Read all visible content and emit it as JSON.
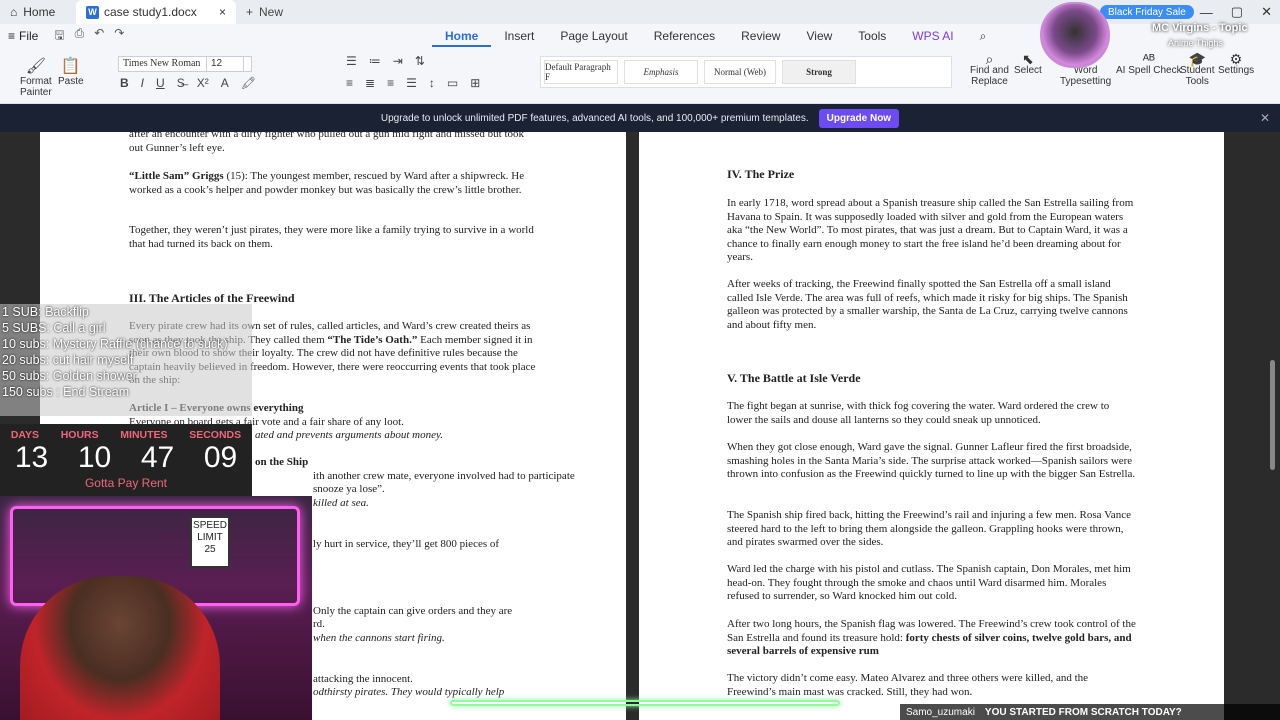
{
  "titlebar": {
    "home": "Home",
    "doc_tab": "case study1.docx",
    "new_tab": "New",
    "promo": "Black Friday Sale"
  },
  "menubar": {
    "file": "File",
    "tabs": [
      "Home",
      "Insert",
      "Page Layout",
      "References",
      "Review",
      "View",
      "Tools",
      "WPS AI"
    ]
  },
  "ribbon": {
    "format_painter": "Format\nPainter",
    "paste": "Paste",
    "font": "Times New Roman",
    "size": "12",
    "styles": [
      "Default Paragraph F",
      "Emphasis",
      "Normal (Web)",
      "Strong"
    ],
    "find_replace": "Find and\nReplace",
    "select": "Select",
    "word_typesetting": "Word\nTypesetting",
    "ai_spell": "AI Spell Check",
    "student_tools": "Student\nTools",
    "settings": "Settings"
  },
  "upgrade": {
    "text": "Upgrade to unlock unlimited PDF features, advanced AI tools, and 100,000+ premium templates.",
    "button": "Upgrade Now"
  },
  "left_page": {
    "p1": "after an encounter with a dirty fighter who pulled out a gun mid fight and missed but took out Gunner’s left eye.",
    "p2_bold": "“Little Sam” Griggs",
    "p2": " (15): The youngest member, rescued by Ward after a shipwreck. He worked as a cook’s helper and powder monkey but was basically the crew’s little brother.",
    "p3": "Together, they weren’t just pirates, they were more like a family trying to survive in a world that had turned its back on them.",
    "h3": "III. The Articles of the Freewind",
    "p4a": "Every pirate crew had its own set of rules, called articles, and Ward’s crew created theirs as soon as they took the ship. They called them ",
    "p4b": "“The Tide’s Oath.”",
    "p4c": " Each member signed it in their own blood to show their loyalty. The crew did not have definitive rules because the captain heavily believed in freedom. However, there were reoccurring events that took place on the ship:",
    "art1": "Article I – Everyone owns everything",
    "art1a": "Everyone on board gets a fair vote and a fair share of any loot.",
    "art1b": "ated and prevents arguments about money.",
    "art2": "on the Ship",
    "art2a": "ith another crew mate, everyone involved had to participate",
    "art2b": "snooze ya lose”.",
    "art2c": "killed at sea.",
    "art3": "ly hurt in service, they’ll get 800 pieces of",
    "art4": "Only the captain can give orders and they are",
    "art4b": "rd.",
    "art4c": " when the cannons start firing.",
    "art5": "attacking the innocent.",
    "art5b": "odthirsty pirates. They would typically help"
  },
  "right_page": {
    "h4": "IV. The Prize",
    "r1": "In early 1718, word spread about a Spanish treasure ship called the San Estrella sailing from Havana to Spain. It was supposedly loaded with silver and gold from the European waters aka “the New World”. To most pirates, that was just a dream. But to Captain Ward, it was a chance to finally earn enough money to start the free island he’d been dreaming about for years.",
    "r2": "After weeks of tracking, the Freewind finally spotted the San Estrella off a small island called Isle Verde. The area was full of reefs, which made it risky for big ships. The Spanish galleon was protected by a smaller warship, the Santa de La Cruz, carrying twelve cannons and about fifty men.",
    "h5": "V. The Battle at Isle Verde",
    "r3": "The fight began at sunrise, with thick fog covering the water. Ward ordered the crew to lower the sails and douse all lanterns so they could sneak up unnoticed.",
    "r4": "When they got close enough, Ward gave the signal. Gunner Lafleur fired the first broadside, smashing holes in the Santa Maria’s side. The surprise attack worked—Spanish sailors were thrown into confusion as the Freewind quickly turned to line up with the bigger San Estrella.",
    "r5": "The Spanish ship fired back, hitting the Freewind’s rail and injuring a few men. Rosa Vance steered hard to the left to bring them alongside the galleon. Grappling hooks were thrown, and pirates swarmed over the sides.",
    "r6": "Ward led the charge with his pistol and cutlass. The Spanish captain, Don Morales, met him head-on. They fought through the smoke and chaos until Ward disarmed him. Morales refused to surrender, so Ward knocked him out cold.",
    "r7a": "After two long hours, the Spanish flag was lowered. The Freewind’s crew took control of the San Estrella and found its treasure hold: ",
    "r7b": "forty chests of silver coins, twelve gold bars, and several barrels of expensive rum",
    "r8": "The victory didn’t come easy. Mateo Alvarez and three others were killed, and the Freewind’s main mast was cracked. Still, they had won."
  },
  "overlay": {
    "subgoals": [
      "1 SUB: Backflip",
      "5 SUBS: Call a girl",
      "10 subs: Mystery Raffle (chance to suck)",
      "20 subs: cut hair myself",
      "50 subs: Golden shower",
      "150 subs : End Stream"
    ],
    "timer_labels": [
      "DAYS",
      "HOURS",
      "MINUTES",
      "SECONDS"
    ],
    "timer_values": [
      "13",
      "10",
      "47",
      "09"
    ],
    "timer_sub": "Gotta Pay Rent",
    "sign": "SPEED LIMIT 25",
    "streamer_title": "MC Virgins - Topic",
    "streamer_sub": "Anime Thighs",
    "chat_user": "Samo_uzumaki",
    "chat_msg": "YOU STARTED FROM SCRATCH TODAY?"
  }
}
